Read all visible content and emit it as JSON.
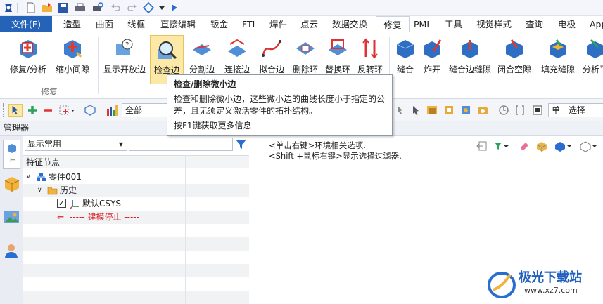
{
  "quick_access": {
    "icons": [
      "app-logo-icon",
      "new-file-icon",
      "open-folder-icon",
      "save-icon",
      "print-icon",
      "print-preview-icon",
      "undo-icon",
      "redo-icon",
      "regen-icon",
      "dropdown-icon",
      "run-icon"
    ]
  },
  "menu": {
    "file": "文件(F)",
    "tabs": [
      "造型",
      "曲面",
      "线框",
      "直接编辑",
      "钣金",
      "FTI",
      "焊件",
      "点云",
      "数据交换",
      "修复",
      "PMI",
      "工具",
      "视觉样式",
      "查询",
      "电极",
      "App"
    ],
    "active": "修复"
  },
  "ribbon": {
    "buttons": [
      {
        "label": "修复/分析",
        "icon": "repair-analysis-icon"
      },
      {
        "label": "缩小间隙",
        "icon": "shrink-gap-icon"
      },
      {
        "label": "显示开放边",
        "icon": "show-open-edges-icon"
      },
      {
        "label": "检查边",
        "icon": "check-edge-icon"
      },
      {
        "label": "分割边",
        "icon": "split-edge-icon"
      },
      {
        "label": "连接边",
        "icon": "join-edge-icon"
      },
      {
        "label": "拟合边",
        "icon": "fit-edge-icon"
      },
      {
        "label": "删除环",
        "icon": "delete-loop-icon"
      },
      {
        "label": "替换环",
        "icon": "replace-loop-icon"
      },
      {
        "label": "反转环",
        "icon": "reverse-loop-icon"
      },
      {
        "label": "缝合",
        "icon": "stitch-icon"
      },
      {
        "label": "炸开",
        "icon": "explode-icon"
      },
      {
        "label": "缝合边缝隙",
        "icon": "stitch-edge-gap-icon"
      },
      {
        "label": "闭合空隙",
        "icon": "close-void-icon"
      },
      {
        "label": "填充缝隙",
        "icon": "fill-gap-icon"
      },
      {
        "label": "分析平",
        "icon": "analyze-flat-icon"
      }
    ],
    "group_label": "修复"
  },
  "toolbar": {
    "filter_value": "全部",
    "selection_mode": "单一选择"
  },
  "panel": {
    "title": "管理器"
  },
  "tree": {
    "filter_select": "显示常用",
    "search_placeholder": "",
    "column_header": "特征节点",
    "nodes": [
      "零件001",
      "历史",
      "默认CSYS",
      "----- 建模停止 -----"
    ]
  },
  "hints": {
    "line1": "<单击右键>环境相关选项.",
    "line2": "<Shift +鼠标右键>显示选择过滤器."
  },
  "tooltip": {
    "title": "检查/删除微小边",
    "body": "检查和删除微小边，这些微小边的曲线长度小于指定的公差，且无须定义激活零件的拓扑结构。",
    "help": "按F1键获取更多信息"
  },
  "watermark": {
    "text": "极光下载站",
    "url": "www.xz7.com"
  },
  "colors": {
    "file_tab": "#2563b8",
    "highlight": "#fde9a7",
    "stop_red": "#d91f26"
  }
}
